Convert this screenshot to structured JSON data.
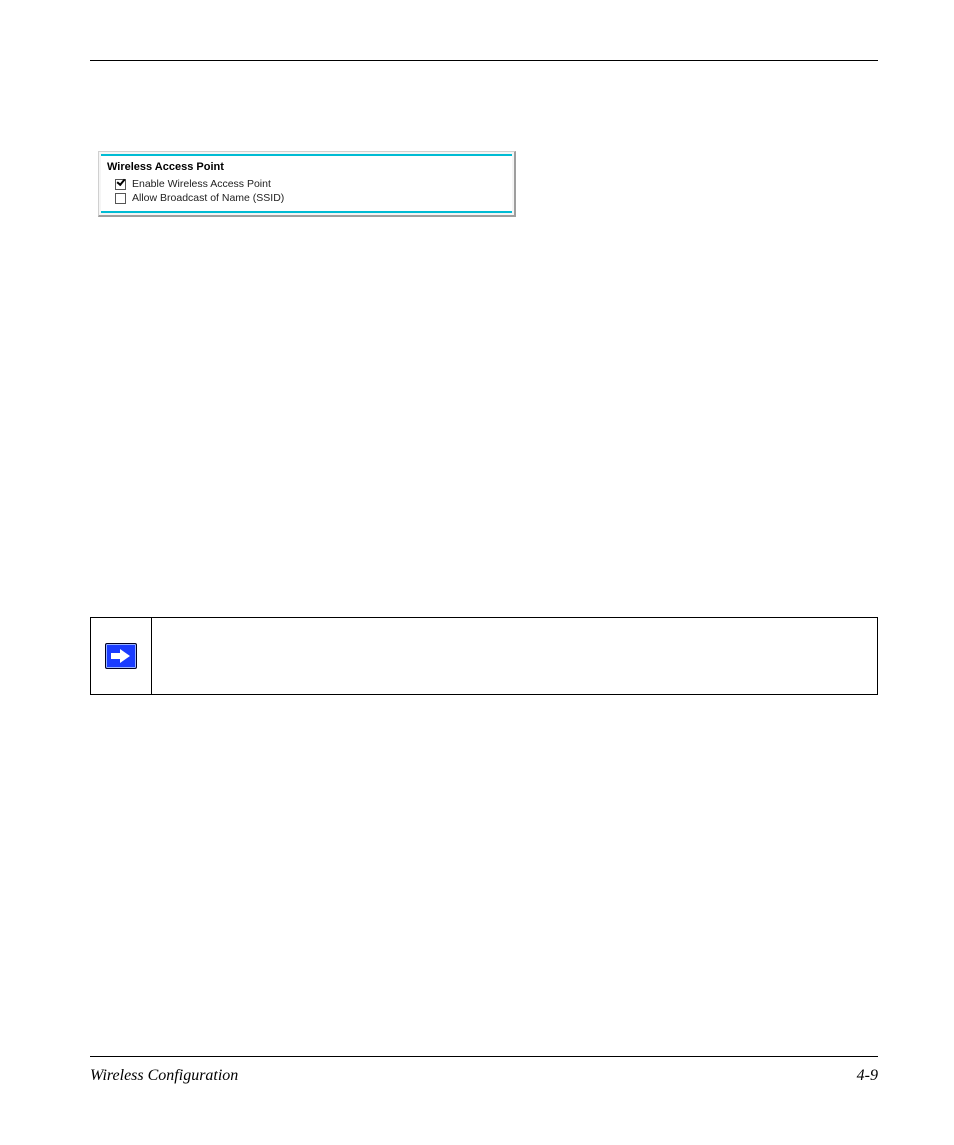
{
  "panel": {
    "title": "Wireless Access Point",
    "options": [
      {
        "label": "Enable Wireless Access Point",
        "checked": true
      },
      {
        "label": "Allow Broadcast of Name (SSID)",
        "checked": false
      }
    ]
  },
  "footer": {
    "left": "Wireless Configuration",
    "right": "4-9"
  }
}
